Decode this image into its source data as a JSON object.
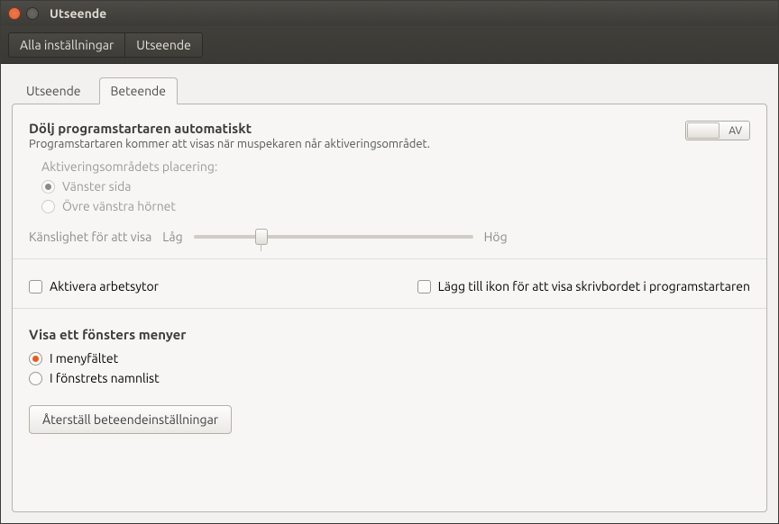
{
  "window": {
    "title": "Utseende"
  },
  "toolbar": {
    "all_settings": "Alla inställningar",
    "section": "Utseende"
  },
  "tabs": {
    "appearance": "Utseende",
    "behaviour": "Beteende"
  },
  "autohide": {
    "title": "Dölj programstartaren automatiskt",
    "subtitle": "Programstartaren kommer att visas när muspekaren når aktiveringsområdet.",
    "toggle_label": "AV",
    "area_label": "Aktiveringsområdets placering:",
    "opt_left": "Vänster sida",
    "opt_topleft": "Övre vänstra hörnet",
    "sensitivity_label": "Känslighet för att visa",
    "low": "Låg",
    "high": "Hög"
  },
  "checks": {
    "workspaces": "Aktivera arbetsytor",
    "desktop_icon": "Lägg till ikon för att visa skrivbordet i programstartaren"
  },
  "menus": {
    "title": "Visa ett fönsters menyer",
    "opt_menu_bar": "I menyfältet",
    "opt_titlebar": "I fönstrets namnlist"
  },
  "reset_button": "Återställ beteendeinställningar"
}
